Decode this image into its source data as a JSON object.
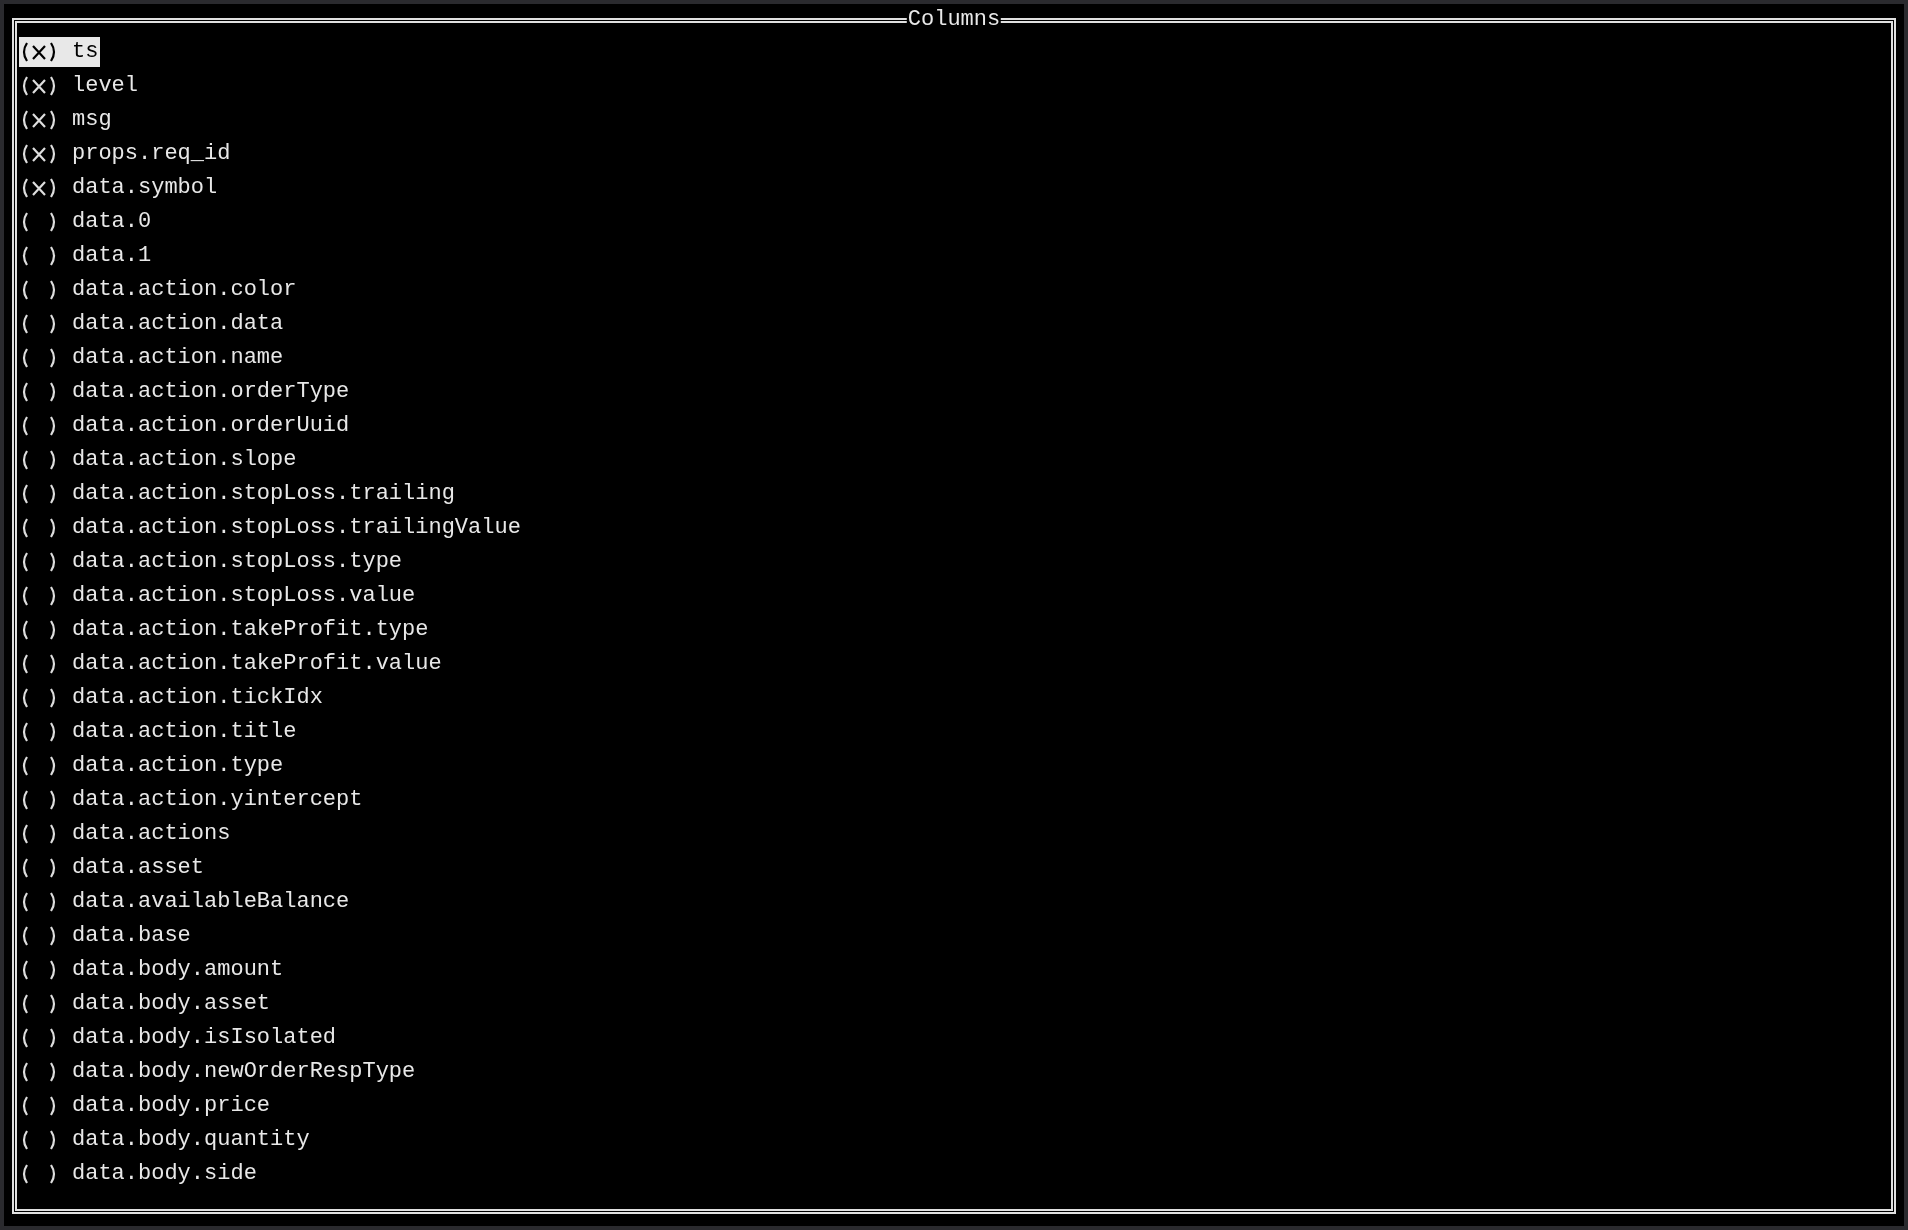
{
  "panel": {
    "title": "Columns"
  },
  "columns": [
    {
      "label": "ts",
      "checked": true,
      "selected": true
    },
    {
      "label": "level",
      "checked": true,
      "selected": false
    },
    {
      "label": "msg",
      "checked": true,
      "selected": false
    },
    {
      "label": "props.req_id",
      "checked": true,
      "selected": false
    },
    {
      "label": "data.symbol",
      "checked": true,
      "selected": false
    },
    {
      "label": "data.0",
      "checked": false,
      "selected": false
    },
    {
      "label": "data.1",
      "checked": false,
      "selected": false
    },
    {
      "label": "data.action.color",
      "checked": false,
      "selected": false
    },
    {
      "label": "data.action.data",
      "checked": false,
      "selected": false
    },
    {
      "label": "data.action.name",
      "checked": false,
      "selected": false
    },
    {
      "label": "data.action.orderType",
      "checked": false,
      "selected": false
    },
    {
      "label": "data.action.orderUuid",
      "checked": false,
      "selected": false
    },
    {
      "label": "data.action.slope",
      "checked": false,
      "selected": false
    },
    {
      "label": "data.action.stopLoss.trailing",
      "checked": false,
      "selected": false
    },
    {
      "label": "data.action.stopLoss.trailingValue",
      "checked": false,
      "selected": false
    },
    {
      "label": "data.action.stopLoss.type",
      "checked": false,
      "selected": false
    },
    {
      "label": "data.action.stopLoss.value",
      "checked": false,
      "selected": false
    },
    {
      "label": "data.action.takeProfit.type",
      "checked": false,
      "selected": false
    },
    {
      "label": "data.action.takeProfit.value",
      "checked": false,
      "selected": false
    },
    {
      "label": "data.action.tickIdx",
      "checked": false,
      "selected": false
    },
    {
      "label": "data.action.title",
      "checked": false,
      "selected": false
    },
    {
      "label": "data.action.type",
      "checked": false,
      "selected": false
    },
    {
      "label": "data.action.yintercept",
      "checked": false,
      "selected": false
    },
    {
      "label": "data.actions",
      "checked": false,
      "selected": false
    },
    {
      "label": "data.asset",
      "checked": false,
      "selected": false
    },
    {
      "label": "data.availableBalance",
      "checked": false,
      "selected": false
    },
    {
      "label": "data.base",
      "checked": false,
      "selected": false
    },
    {
      "label": "data.body.amount",
      "checked": false,
      "selected": false
    },
    {
      "label": "data.body.asset",
      "checked": false,
      "selected": false
    },
    {
      "label": "data.body.isIsolated",
      "checked": false,
      "selected": false
    },
    {
      "label": "data.body.newOrderRespType",
      "checked": false,
      "selected": false
    },
    {
      "label": "data.body.price",
      "checked": false,
      "selected": false
    },
    {
      "label": "data.body.quantity",
      "checked": false,
      "selected": false
    },
    {
      "label": "data.body.side",
      "checked": false,
      "selected": false
    }
  ]
}
